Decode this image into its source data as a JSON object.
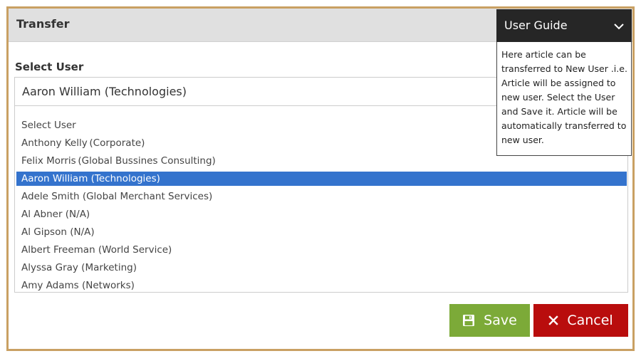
{
  "dialog": {
    "title": "Transfer",
    "field_label": "Select User",
    "selected_value": "Aaron William (Technologies)"
  },
  "options": [
    {
      "label": "Select User",
      "selected": false
    },
    {
      "label": "Anthony Kelly (Corporate)",
      "selected": false
    },
    {
      "label": "Felix Morris (Global Bussines Consulting)",
      "selected": false
    },
    {
      "label": "Aaron William (Technologies)",
      "selected": true
    },
    {
      "label": "Adele Smith (Global Merchant Services)",
      "selected": false
    },
    {
      "label": "Al Abner (N/A)",
      "selected": false
    },
    {
      "label": "Al Gipson (N/A)",
      "selected": false
    },
    {
      "label": "Albert Freeman (World Service)",
      "selected": false
    },
    {
      "label": "Alyssa Gray (Marketing)",
      "selected": false
    },
    {
      "label": "Amy Adams (Networks)",
      "selected": false
    }
  ],
  "buttons": {
    "save_label": "Save",
    "save_icon": "floppy-disk-icon",
    "cancel_label": "Cancel",
    "cancel_icon": "close-icon"
  },
  "guide": {
    "title": "User Guide",
    "icon": "chevron-down-icon",
    "text": "Here article can be transferred to New User .i.e. Article will be assigned to new user. Select the User and Save it. Article will be automatically transferred to new user."
  },
  "colors": {
    "frame_border": "#c9a063",
    "selected_option": "#3473cd",
    "save_button": "#7caa38",
    "cancel_button": "#b90d0d",
    "guide_header": "#262626"
  }
}
